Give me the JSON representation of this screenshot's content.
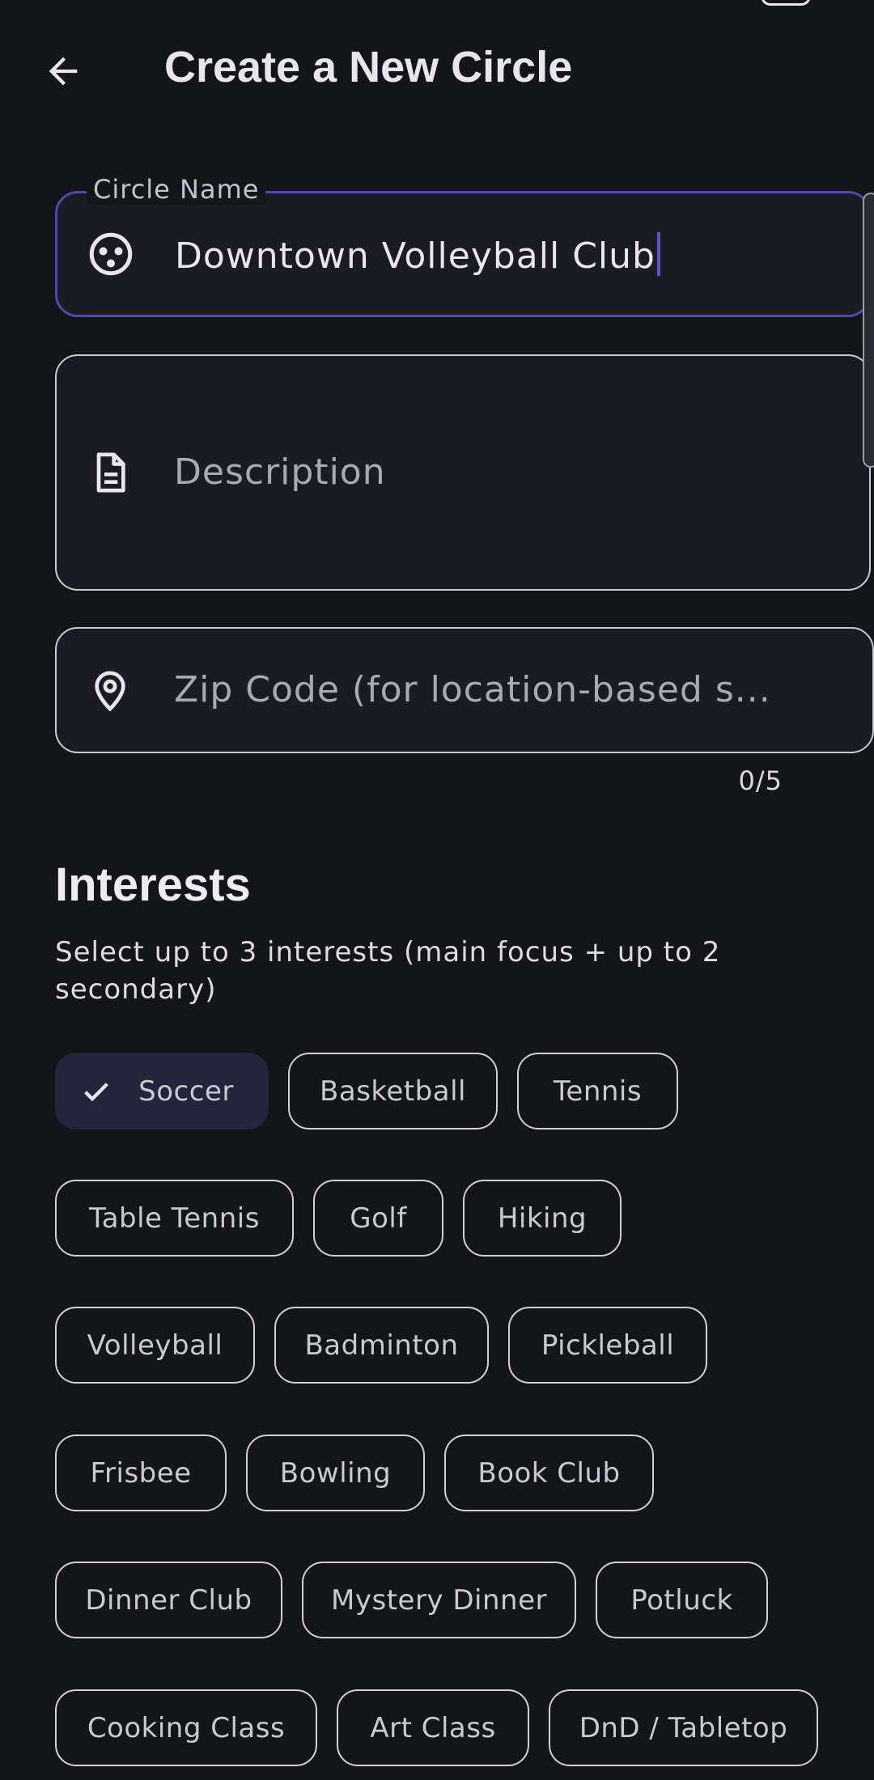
{
  "header": {
    "title": "Create a New Circle",
    "back_icon": "arrow-left-icon"
  },
  "form": {
    "circle_name": {
      "label": "Circle Name",
      "value": "Downtown Volleyball Club",
      "icon": "circle-dots-icon"
    },
    "description": {
      "placeholder": "Description",
      "icon": "document-icon"
    },
    "zip_code": {
      "placeholder": "Zip Code (for location-based s...",
      "icon": "location-pin-icon",
      "counter": "0/5"
    }
  },
  "interests": {
    "title": "Interests",
    "subtitle": "Select up to 3 interests (main focus + up to 2 secondary)",
    "chips": [
      {
        "label": "Soccer",
        "selected": true
      },
      {
        "label": "Basketball",
        "selected": false
      },
      {
        "label": "Tennis",
        "selected": false
      },
      {
        "label": "Table Tennis",
        "selected": false
      },
      {
        "label": "Golf",
        "selected": false
      },
      {
        "label": "Hiking",
        "selected": false
      },
      {
        "label": "Volleyball",
        "selected": false
      },
      {
        "label": "Badminton",
        "selected": false
      },
      {
        "label": "Pickleball",
        "selected": false
      },
      {
        "label": "Frisbee",
        "selected": false
      },
      {
        "label": "Bowling",
        "selected": false
      },
      {
        "label": "Book Club",
        "selected": false
      },
      {
        "label": "Dinner Club",
        "selected": false
      },
      {
        "label": "Mystery Dinner",
        "selected": false
      },
      {
        "label": "Potluck",
        "selected": false
      },
      {
        "label": "Cooking Class",
        "selected": false
      },
      {
        "label": "Art Class",
        "selected": false
      },
      {
        "label": "DnD / Tabletop",
        "selected": false
      }
    ]
  },
  "colors": {
    "background": "#141519",
    "focus_accent": "#4f4aa8",
    "cursor": "#5a55d6",
    "selected_chip": "#25243d"
  }
}
